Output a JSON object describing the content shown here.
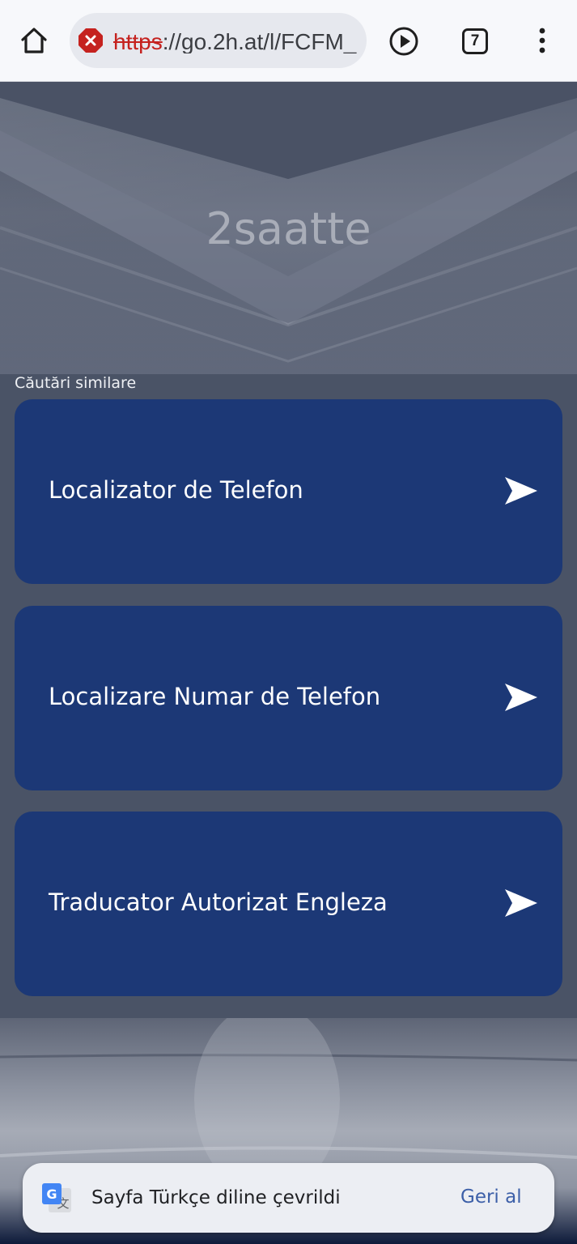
{
  "browser": {
    "url_scheme": "https",
    "url_rest": "://go.2h.at/l/FCFM_",
    "tab_count": "7",
    "security_state": "not-secure",
    "icons": {
      "home": "home-icon",
      "security": "not-secure-icon",
      "play": "play-icon",
      "menu": "more-vert-icon"
    }
  },
  "page": {
    "site_title": "2saatte",
    "similar_heading": "Căutări similare",
    "results": [
      {
        "label": "Localizator de Telefon"
      },
      {
        "label": "Localizare Numar de Telefon"
      },
      {
        "label": "Traducator Autorizat Engleza"
      }
    ],
    "colors": {
      "card": "#1c3876",
      "heading": "#a9adb8"
    }
  },
  "translate_bar": {
    "message": "Sayfa Türkçe diline çevrildi",
    "undo_label": "Geri al",
    "icon": "google-translate-icon"
  }
}
